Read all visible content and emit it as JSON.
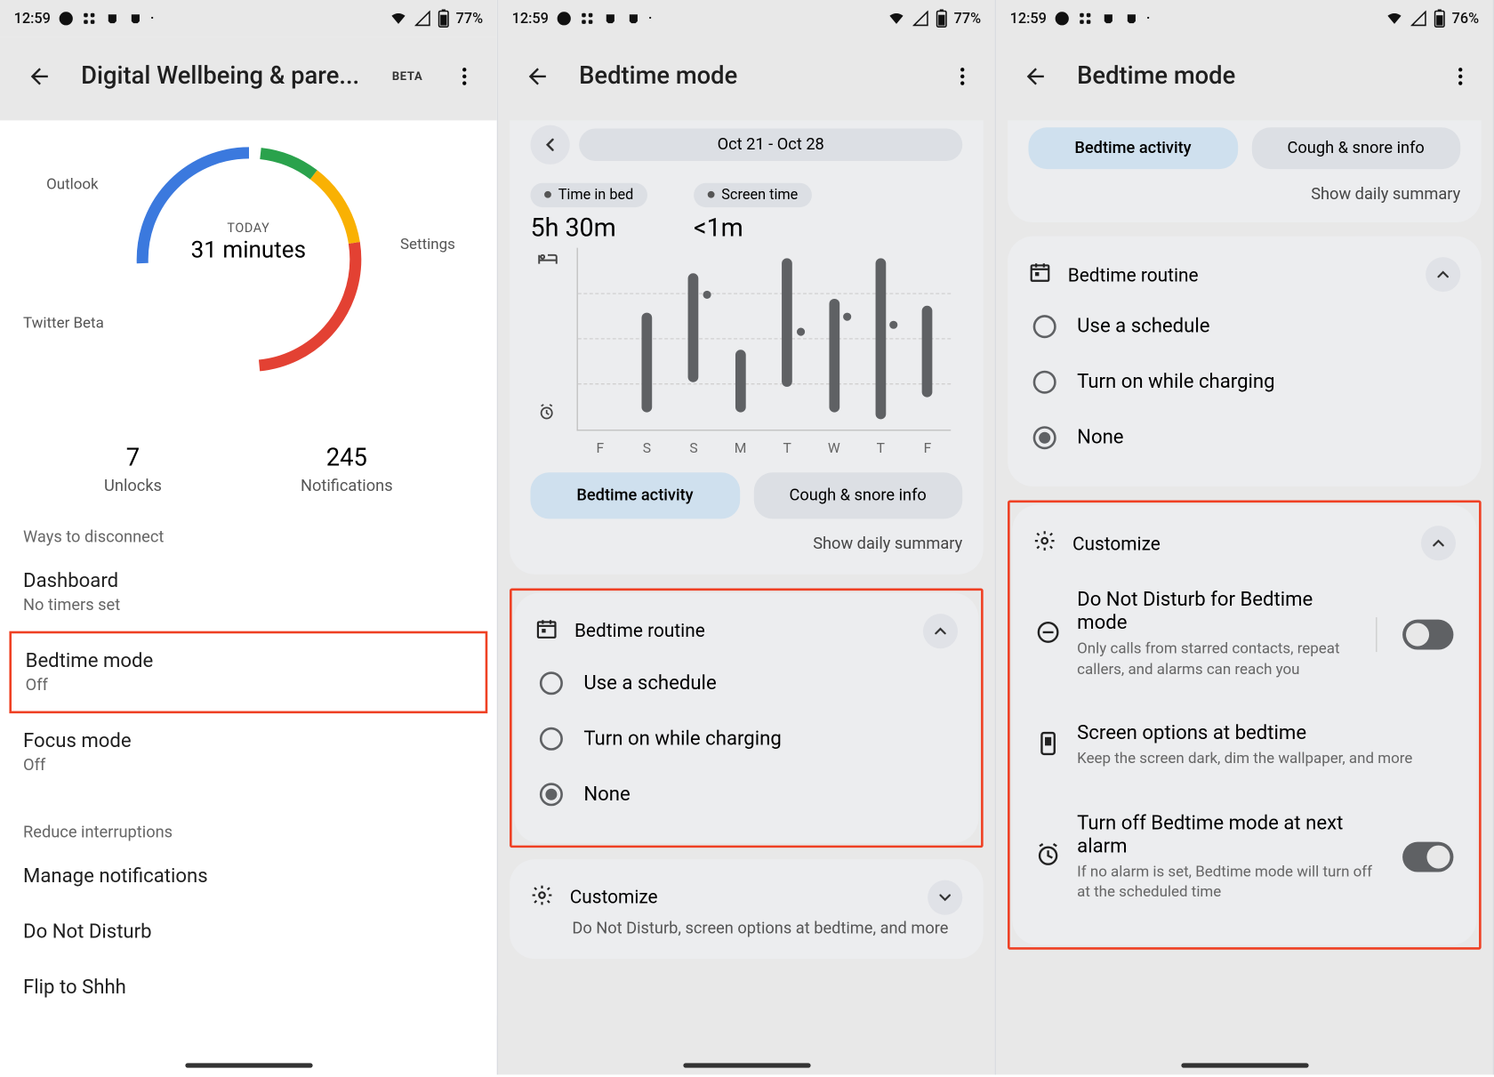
{
  "s1": {
    "status": {
      "time": "12:59",
      "battery": "77%"
    },
    "title": "Digital Wellbeing & pare...",
    "beta": "BETA",
    "donut": {
      "today_label": "TODAY",
      "total": "31 minutes",
      "labels": {
        "outlook": "Outlook",
        "settings": "Settings",
        "twitter": "Twitter Beta"
      }
    },
    "counters": {
      "unlocks_val": "7",
      "unlocks_lbl": "Unlocks",
      "notif_val": "245",
      "notif_lbl": "Notifications"
    },
    "sec_disconnect": "Ways to disconnect",
    "dashboard": {
      "t": "Dashboard",
      "s": "No timers set"
    },
    "bedtime": {
      "t": "Bedtime mode",
      "s": "Off"
    },
    "focus": {
      "t": "Focus mode",
      "s": "Off"
    },
    "sec_reduce": "Reduce interruptions",
    "manage_notif": "Manage notifications",
    "dnd": "Do Not Disturb",
    "flip": "Flip to Shhh"
  },
  "s2": {
    "status": {
      "time": "12:59",
      "battery": "77%"
    },
    "title": "Bedtime mode",
    "date_range": "Oct 21 - Oct 28",
    "metrics": {
      "tib_label": "Time in bed",
      "tib_val": "5h 30m",
      "st_label": "Screen time",
      "st_val": "<1m"
    },
    "tabs": {
      "activity": "Bedtime activity",
      "cough": "Cough & snore info"
    },
    "summary_link": "Show daily summary",
    "routine": {
      "title": "Bedtime routine",
      "opt1": "Use a schedule",
      "opt2": "Turn on while charging",
      "opt3": "None"
    },
    "customize": {
      "title": "Customize",
      "sub": "Do Not Disturb, screen options at bedtime, and more"
    }
  },
  "s3": {
    "status": {
      "time": "12:59",
      "battery": "76%"
    },
    "title": "Bedtime mode",
    "tabs": {
      "activity": "Bedtime activity",
      "cough": "Cough & snore info"
    },
    "summary_link": "Show daily summary",
    "routine": {
      "title": "Bedtime routine",
      "opt1": "Use a schedule",
      "opt2": "Turn on while charging",
      "opt3": "None"
    },
    "customize": {
      "title": "Customize",
      "dnd_t": "Do Not Disturb for Bedtime mode",
      "dnd_s": "Only calls from starred contacts, repeat callers, and alarms can reach you",
      "screen_t": "Screen options at bedtime",
      "screen_s": "Keep the screen dark, dim the wallpaper, and more",
      "alarm_t": "Turn off Bedtime mode at next alarm",
      "alarm_s": "If no alarm is set, Bedtime mode will turn off at the scheduled time"
    }
  },
  "chart_data": {
    "type": "bar",
    "title": "Bedtime activity Oct 21 - Oct 28",
    "categories": [
      "F",
      "S",
      "S",
      "M",
      "T",
      "W",
      "T",
      "F"
    ],
    "series": [
      {
        "name": "Time in bed (hours, rendered as vertical range bars)",
        "ranges_pct_from_top": [
          null,
          [
            36,
            90
          ],
          [
            14,
            74
          ],
          [
            56,
            90
          ],
          [
            6,
            76
          ],
          [
            28,
            90
          ],
          [
            6,
            94
          ],
          [
            32,
            82
          ]
        ]
      },
      {
        "name": "Screen time markers (dot y-positions pct from top)",
        "points_pct_from_top": [
          null,
          null,
          24,
          null,
          44,
          36,
          40,
          null
        ]
      }
    ],
    "summary": {
      "time_in_bed": "5h 30m",
      "screen_time": "<1m"
    }
  }
}
